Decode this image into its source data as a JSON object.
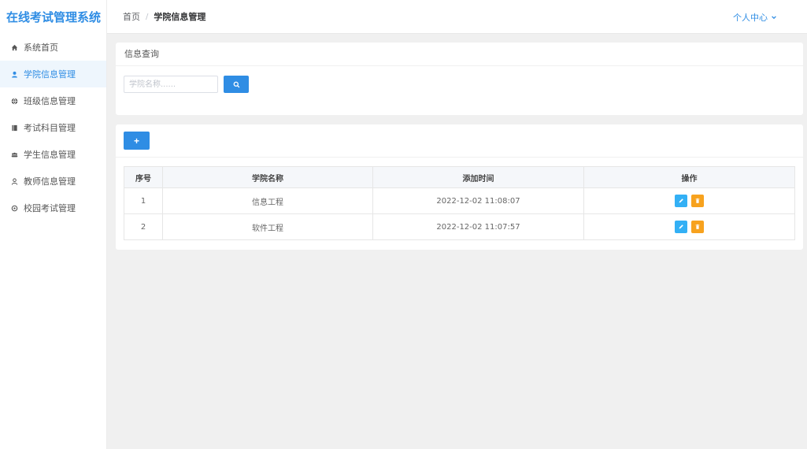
{
  "app": {
    "title": "在线考试管理系统"
  },
  "sidebar": {
    "items": [
      {
        "label": "系统首页",
        "icon": "home-icon",
        "active": false
      },
      {
        "label": "学院信息管理",
        "icon": "user-icon",
        "active": true
      },
      {
        "label": "班级信息管理",
        "icon": "globe-icon",
        "active": false
      },
      {
        "label": "考试科目管理",
        "icon": "book-icon",
        "active": false
      },
      {
        "label": "学生信息管理",
        "icon": "group-icon",
        "active": false
      },
      {
        "label": "教师信息管理",
        "icon": "person-icon",
        "active": false
      },
      {
        "label": "校园考试管理",
        "icon": "gear-icon",
        "active": false
      }
    ]
  },
  "header": {
    "breadcrumb": {
      "home": "首页",
      "separator": "/",
      "current": "学院信息管理"
    },
    "user_menu": "个人中心"
  },
  "search": {
    "title": "信息查询",
    "placeholder": "学院名称......",
    "value": ""
  },
  "toolbar": {
    "add_label": "+"
  },
  "table": {
    "headers": {
      "seq": "序号",
      "name": "学院名称",
      "time": "添加时间",
      "ops": "操作"
    },
    "rows": [
      {
        "seq": "1",
        "name": "信息工程",
        "time": "2022-12-02 11:08:07"
      },
      {
        "seq": "2",
        "name": "软件工程",
        "time": "2022-12-02 11:07:57"
      }
    ]
  },
  "colors": {
    "accent": "#2f8de4",
    "edit": "#33b0f5",
    "delete": "#f7a21e",
    "background": "#f0f0f0"
  }
}
